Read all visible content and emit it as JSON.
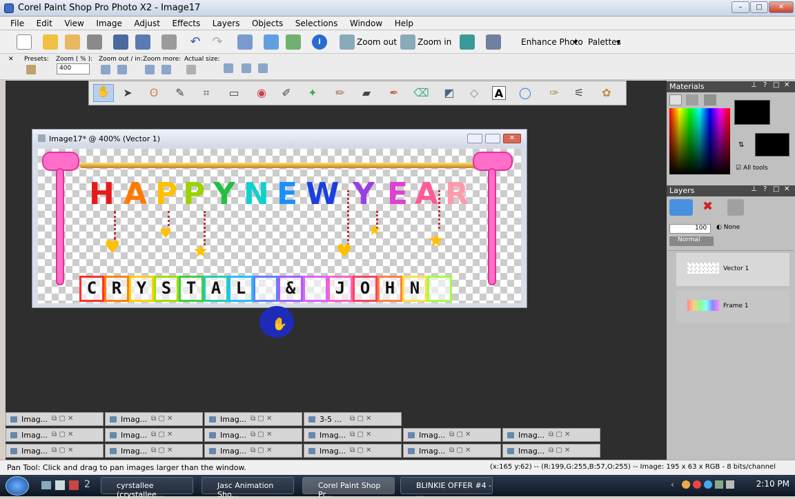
{
  "window": {
    "title": "Corel Paint Shop Pro Photo X2 - Image17"
  },
  "menu": [
    "File",
    "Edit",
    "View",
    "Image",
    "Adjust",
    "Effects",
    "Layers",
    "Objects",
    "Selections",
    "Window",
    "Help"
  ],
  "toolbar": {
    "zoom_out": "Zoom out",
    "zoom_in": "Zoom in",
    "enhance_photo": "Enhance Photo",
    "palettes": "Palettes"
  },
  "tool_options": {
    "presets_label": "Presets:",
    "zoom_label": "Zoom ( % ):",
    "zoom_value": "400",
    "zoom_out_in_label": "Zoom out / in:",
    "zoom_more_label": "Zoom more:",
    "actual_size_label": "Actual size:"
  },
  "image_window": {
    "title": "Image17* @ 400% (Vector 1)"
  },
  "artwork": {
    "headline": [
      {
        "ch": "H",
        "color": "#e61a1a"
      },
      {
        "ch": "A",
        "color": "#ff7a00"
      },
      {
        "ch": "P",
        "color": "#ffc000"
      },
      {
        "ch": "P",
        "color": "#9ad400"
      },
      {
        "ch": "Y",
        "color": "#22c040"
      },
      {
        "ch": "N",
        "color": "#10d0d0"
      },
      {
        "ch": "E",
        "color": "#1a90ff"
      },
      {
        "ch": "W",
        "color": "#1a40e0"
      },
      {
        "ch": "Y",
        "color": "#9a40e0"
      },
      {
        "ch": "E",
        "color": "#e040d0"
      },
      {
        "ch": "A",
        "color": "#ff5a9a"
      },
      {
        "ch": "R",
        "color": "#ff9aaa"
      }
    ],
    "names": [
      {
        "ch": "C",
        "border": "#ff3030"
      },
      {
        "ch": "R",
        "border": "#ff8000"
      },
      {
        "ch": "Y",
        "border": "#ffd000"
      },
      {
        "ch": "S",
        "border": "#a0e000"
      },
      {
        "ch": "T",
        "border": "#40d040"
      },
      {
        "ch": "A",
        "border": "#20d0b0"
      },
      {
        "ch": "L",
        "border": "#20c0ff"
      },
      {
        "ch": "",
        "border": "#6080ff"
      },
      {
        "ch": "&",
        "border": "#a060ff"
      },
      {
        "ch": "",
        "border": "#e060ff"
      },
      {
        "ch": "J",
        "border": "#ff60c0"
      },
      {
        "ch": "O",
        "border": "#ff4060"
      },
      {
        "ch": "H",
        "border": "#ff8040"
      },
      {
        "ch": "N",
        "border": "#ffe040"
      },
      {
        "ch": "",
        "border": "#a0ff40"
      }
    ]
  },
  "materials": {
    "title": "Materials",
    "all_tools": "All tools"
  },
  "layers": {
    "title": "Layers",
    "opacity": "100",
    "mode": "Normal",
    "mask": "None",
    "items": [
      "Vector 1",
      "Frame 1"
    ]
  },
  "mini_windows": [
    [
      "Imag...",
      "Imag...",
      "Imag...",
      "3-5 ..."
    ],
    [
      "Imag...",
      "Imag...",
      "Imag...",
      "Imag...",
      "Imag...",
      "Imag..."
    ],
    [
      "Imag...",
      "Imag...",
      "Imag...",
      "Imag...",
      "Imag...",
      "Imag..."
    ]
  ],
  "status": {
    "left": "Pan Tool: Click and drag to pan images larger than the window.",
    "right": "(x:165 y:62) -- (R:199,G:255,B:57,O:255) -- Image: 195 x 63 x RGB - 8 bits/channel"
  },
  "taskbar": {
    "tasks": [
      "cyrstallee (crystallee...",
      "Jasc Animation Sho...",
      "Corel Paint Shop Pr...",
      "BLINKIE OFFER #4 - ..."
    ],
    "clock": "2:10 PM"
  }
}
